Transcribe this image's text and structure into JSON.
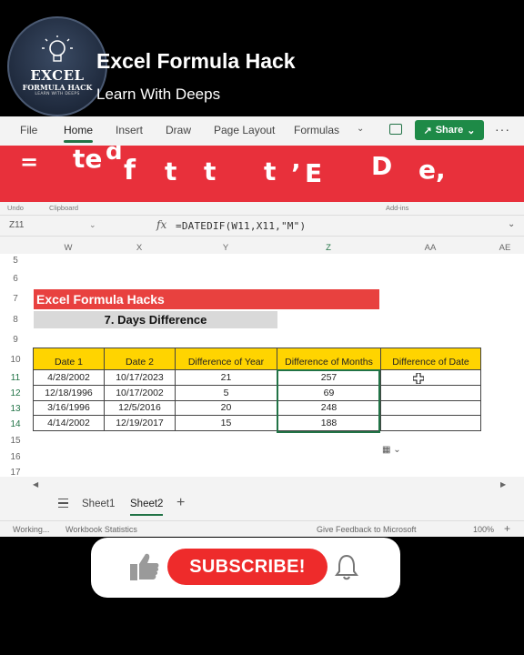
{
  "channel": {
    "logo_line1": "EXCEL",
    "logo_line2": "FORMULA HACK",
    "logo_line3": "LEARN WITH DEEPS",
    "title": "Excel Formula Hack",
    "subtitle": "Learn With Deeps"
  },
  "ribbon": {
    "tabs": [
      "File",
      "Home",
      "Insert",
      "Draw",
      "Page Layout",
      "Formulas"
    ],
    "active_tab": "Home",
    "share_label": "Share"
  },
  "banner": {
    "color": "#e8303b",
    "glyphs": [
      "=",
      "te",
      "d",
      "f",
      "t",
      "t",
      "t",
      "’",
      "E",
      "D",
      "e,"
    ]
  },
  "group_labels": [
    "Undo",
    "Clipboard",
    "Add-ins"
  ],
  "formula_bar": {
    "name_box": "Z11",
    "fx": "fx",
    "formula": "=DATEDIF(W11,X11,\"M\")"
  },
  "columns": [
    "W",
    "X",
    "Y",
    "Z",
    "AA",
    "AE"
  ],
  "rows": [
    "5",
    "6",
    "7",
    "8",
    "9",
    "10",
    "11",
    "12",
    "13",
    "14",
    "15",
    "16",
    "17"
  ],
  "sheet": {
    "title": "Excel Formula Hacks",
    "subtitle": "7. Days Difference",
    "headers": [
      "Date 1",
      "Date 2",
      "Difference of Year",
      "Difference of Months",
      "Difference of Date"
    ],
    "data": [
      [
        "4/28/2002",
        "10/17/2023",
        "21",
        "257",
        ""
      ],
      [
        "12/18/1996",
        "10/17/2002",
        "5",
        "69",
        ""
      ],
      [
        "3/16/1996",
        "12/5/2016",
        "20",
        "248",
        ""
      ],
      [
        "4/14/2002",
        "12/19/2017",
        "15",
        "188",
        ""
      ]
    ]
  },
  "sheet_tabs": [
    "Sheet1",
    "Sheet2"
  ],
  "active_sheet": "Sheet2",
  "status": {
    "left1": "Working...",
    "left2": "Workbook Statistics",
    "feedback": "Give Feedback to Microsoft",
    "zoom": "100%"
  },
  "subscribe": {
    "label": "SUBSCRIBE!"
  },
  "colors": {
    "excel_green": "#217346",
    "header_yellow": "#ffd400",
    "title_red": "#e8413f",
    "subscribe_red": "#ee2b2b"
  }
}
